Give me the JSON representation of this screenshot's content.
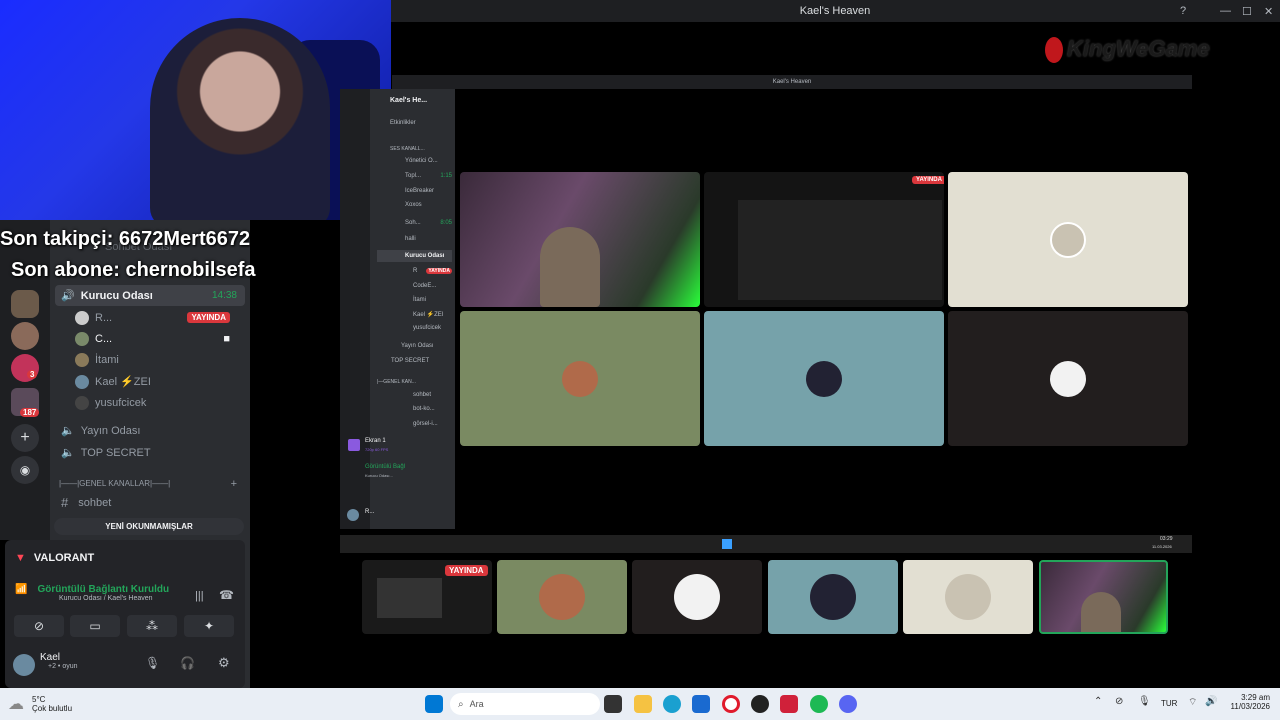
{
  "window": {
    "title": "Kael's Heaven",
    "inner_title": "Kael's Heaven"
  },
  "stream_overlay": {
    "last_follower": "Son takipçi: 6672Mert6672",
    "last_subscriber": "Son abone: chernobilsefa",
    "logo_text": "KingWeGame"
  },
  "left_panel": {
    "servers": [
      {
        "badge": ""
      },
      {
        "badge": ""
      },
      {
        "badge": "3"
      },
      {
        "badge": "187"
      }
    ],
    "ghost_channel": "Sohbet Odası",
    "voice_channel": {
      "name": "Kurucu Odası",
      "time": "14:38",
      "members": [
        {
          "name": "R...",
          "badge": "YAYINDA"
        },
        {
          "name": "C...",
          "badge": ""
        },
        {
          "name": "İtami",
          "badge": ""
        },
        {
          "name": "Kael ⚡ZEI",
          "badge": ""
        },
        {
          "name": "yusufcicek",
          "badge": ""
        }
      ]
    },
    "channels": [
      {
        "name": "Yayın Odası"
      },
      {
        "name": "TOP SECRET"
      }
    ],
    "category": "|——|GENEL KANALLAR|——|",
    "text_channel": "sohbet",
    "unread_button": "YENİ OKUNMAMIŞLAR",
    "activity": "VALORANT",
    "connection": {
      "status": "Görüntülü Bağlantı Kuruldu",
      "detail": "Kurucu Odası / Kael's Heaven"
    },
    "user": {
      "name": "Kael",
      "status": "+2 • oyun"
    }
  },
  "inner_discord": {
    "server_name": "Kael's He...",
    "events": "Etkinlikler",
    "category": "SES KANALL...",
    "rows": [
      {
        "label": "Yönetici O...",
        "time": ""
      },
      {
        "label": "Topl...",
        "time": "1:15"
      },
      {
        "label": "IcеBreaker",
        "time": ""
      },
      {
        "label": "Xoxos",
        "time": ""
      },
      {
        "label": "Soh...",
        "time": "8:05"
      },
      {
        "label": "halli",
        "time": ""
      },
      {
        "label": "Kurucu Odası",
        "time": ""
      },
      {
        "label": "R",
        "time": "YAYINDA"
      },
      {
        "label": "CodeE...",
        "time": ""
      },
      {
        "label": "İtami",
        "time": ""
      },
      {
        "label": "Kael ⚡ZEI",
        "time": ""
      },
      {
        "label": "yusufcicek",
        "time": ""
      },
      {
        "label": "Yayın Odası",
        "time": ""
      },
      {
        "label": "TOP SECRET",
        "time": ""
      },
      {
        "label": "|—GENEL KAN...",
        "time": ""
      },
      {
        "label": "sohbet",
        "time": ""
      },
      {
        "label": "bot-ko...",
        "time": ""
      },
      {
        "label": "görsel-i...",
        "time": ""
      }
    ],
    "screen_share": {
      "title": "Ekran 1",
      "detail": "720p 60 FPS"
    },
    "voice": {
      "status": "Görüntülü Bağl",
      "detail": "Kurucu Odası..."
    },
    "user": "R...",
    "grid_badge": "YAYINDA",
    "tray_time": "03:29",
    "tray_date": "11.03.2026"
  },
  "strip": {
    "live_badge": "YAYINDA"
  },
  "taskbar": {
    "weather_temp": "5°C",
    "weather_desc": "Çok bulutlu",
    "search_placeholder": "Ara",
    "language": "TUR",
    "time": "3:29 am",
    "date": "11/03/2026"
  },
  "colors": {
    "discord_dark": "#1e1f22",
    "discord_panel": "#2b2d31",
    "live_red": "#da373c",
    "green": "#23a55a",
    "webcam_blue": "#1a2cff"
  }
}
